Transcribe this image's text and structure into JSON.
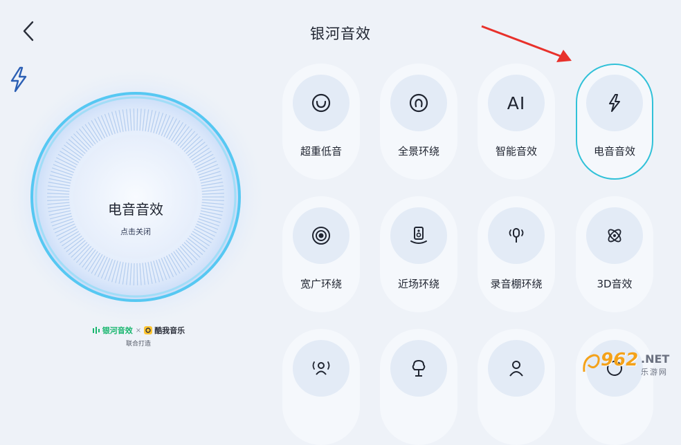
{
  "header": {
    "title": "银河音效",
    "back_icon": "chevron-left-icon"
  },
  "dial": {
    "icon": "lightning-icon",
    "label": "电音音效",
    "sub_label": "点击关闭",
    "colors": {
      "outer_glow": "#d6e6fb",
      "ring": "#4cc9f0",
      "inner": "#e9f1fc"
    }
  },
  "credit": {
    "brand1": "银河音效",
    "separator": "×",
    "brand2": "酷我音乐",
    "sub": "联合打造"
  },
  "effects": [
    {
      "label": "超重低音",
      "icon": "smile-ring-icon",
      "active": false
    },
    {
      "label": "全景环绕",
      "icon": "surround-ring-icon",
      "active": false
    },
    {
      "label": "智能音效",
      "icon": "ai-text-icon",
      "icon_text": "AI",
      "active": false
    },
    {
      "label": "电音音效",
      "icon": "lightning-icon",
      "active": true
    },
    {
      "label": "宽广环绕",
      "icon": "wide-target-icon",
      "active": false
    },
    {
      "label": "近场环绕",
      "icon": "speaker-icon",
      "active": false
    },
    {
      "label": "录音棚环绕",
      "icon": "microphone-icon",
      "active": false
    },
    {
      "label": "3D音效",
      "icon": "atom-3d-icon",
      "active": false
    },
    {
      "label": "",
      "icon": "person-waves-icon",
      "active": false
    },
    {
      "label": "",
      "icon": "tree-icon",
      "active": false
    },
    {
      "label": "",
      "icon": "person-icon",
      "active": false
    },
    {
      "label": "",
      "icon": "unknown-icon",
      "active": false
    }
  ],
  "watermark": {
    "number": "962",
    "suffix": ".NET",
    "cn": "乐游网"
  },
  "accent_color": "#30c1d8",
  "arrow_color": "#e8312b"
}
